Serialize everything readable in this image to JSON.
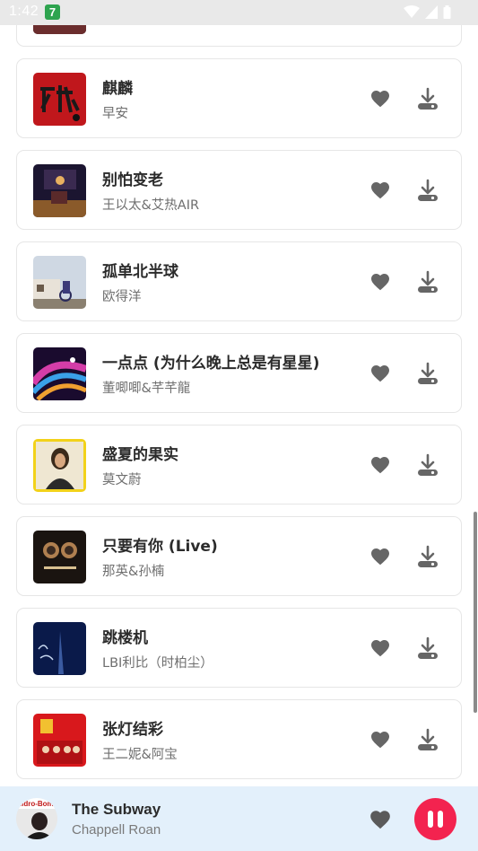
{
  "status": {
    "time": "1:42",
    "app_badge": "7"
  },
  "songs": [
    {
      "title": "",
      "artist": "",
      "cover_colors": [
        "#1a1a2e",
        "#6b2d2d"
      ]
    },
    {
      "title": "麒麟",
      "artist": "早安",
      "cover_colors": [
        "#c0171c",
        "#1a1a1a"
      ]
    },
    {
      "title": "别怕变老",
      "artist": "王以太&艾热AIR",
      "cover_colors": [
        "#1b1530",
        "#8a5a2a"
      ]
    },
    {
      "title": "孤单北半球",
      "artist": "欧得洋",
      "cover_colors": [
        "#cfd8e3",
        "#6a5a4a"
      ]
    },
    {
      "title": "一点点 (为什么晚上总是有星星)",
      "artist": "董唧唧&芊芊龍",
      "cover_colors": [
        "#1a0b2e",
        "#d43da8"
      ]
    },
    {
      "title": "盛夏的果实",
      "artist": "莫文蔚",
      "cover_colors": [
        "#f2d21a",
        "#7a4a2a"
      ]
    },
    {
      "title": "只要有你 (Live)",
      "artist": "那英&孙楠",
      "cover_colors": [
        "#1a1410",
        "#b08050"
      ]
    },
    {
      "title": "跳楼机",
      "artist": "LBI利比（时柏尘）",
      "cover_colors": [
        "#0a1a4a",
        "#3a5aa0"
      ]
    },
    {
      "title": "张灯结彩",
      "artist": "王二妮&阿宝",
      "cover_colors": [
        "#d8181c",
        "#f2c030"
      ]
    }
  ],
  "player": {
    "title": "The Subway",
    "artist": "Chappell Roan",
    "cover_text": "Midro-Bomb"
  },
  "icons": {
    "like": "heart-icon",
    "download": "download-icon",
    "pause": "pause-icon"
  },
  "colors": {
    "accent": "#f3234f",
    "icon_gray": "#666666",
    "player_bg": "#e3f0fb"
  }
}
